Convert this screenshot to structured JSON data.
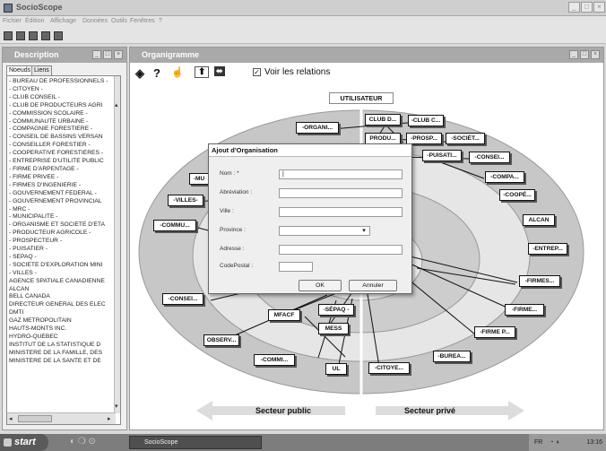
{
  "window": {
    "title": "SocioScope"
  },
  "menu": [
    "Fichier",
    "Édition",
    "Affichage",
    "Données",
    "Outils",
    "Fenêtres",
    "?"
  ],
  "description_panel": {
    "title": "Description",
    "tabs": [
      "Noeuds",
      "Liens"
    ],
    "tree_items": [
      "- BUREAU DE PROFESSIONNELS -",
      "- CITOYEN -",
      "- CLUB CONSEIL -",
      "- CLUB DE PRODUCTEURS AGRI",
      "- COMMISSION SCOLAIRE -",
      "- COMMUNAUTÉ URBAINE -",
      "- COMPAGNIE FORESTIÈRE -",
      "- CONSEIL DE BASSINS VERSAN",
      "- CONSEILLER FORESTIER -",
      "- COOPÉRATIVE FORESTIÈRES -",
      "- ENTREPRISE D'UTILITÉ PUBLIC",
      "- FIRME D'ARPENTAGE -",
      "- FIRME PRIVÉE -",
      "- FIRMES D'INGÉNIERIE -",
      "- GOUVERNEMENT FÉDÉRAL -",
      "- GOUVERNEMENT PROVINCIAL",
      "- MRC -",
      "- MUNICIPALITÉ -",
      "- ORGANISME ET SOCIÉTÉ D'ÉTA",
      "- PRODUCTEUR AGRICOLE -",
      "- PROSPECTEUR -",
      "- PUISATIER -",
      "- SÉPAQ -",
      "- SOCIÉTÉ D'EXPLORATION MINI",
      "- VILLES -",
      "AGENCE SPATIALE CANADIENNE",
      "ALCAN",
      "BELL CANADA",
      "DIRECTEUR GÉNÉRAL DES ÉLEC",
      "DMTI",
      "GAZ MÉTROPOLITAIN",
      "HAUTS-MONTS INC.",
      "HYDRO-QUÉBEC",
      "INSTITUT DE LA STATISTIQUE D",
      "MINISTÈRE DE LA FAMILLE, DES",
      "MINISTÈRE DE LA SANTÉ ET DE"
    ]
  },
  "org_panel": {
    "title": "Organigramme",
    "checkbox_label": "Voir les relations",
    "checkbox_checked": true,
    "center_label": "UTILISATEUR",
    "sector_left": "Secteur public",
    "sector_right": "Secteur privé",
    "nodes": {
      "organi": "-ORGANI...",
      "club_d": "CLUB D...",
      "club_c": "-CLUB C...",
      "produ": "PRODU...",
      "prosp": "-PROSP...",
      "societ": "-SOCIÉT...",
      "puisat": "-PUISATI...",
      "consei_r": "-CONSEI...",
      "compa": "-COMPA...",
      "coope": "-COOPÉ...",
      "mu": "-MU",
      "villes": "-VILLES-",
      "alcan": "ALCAN",
      "commu": "-COMMU...",
      "entrep": "-ENTREP...",
      "firmes": "-FIRMES...",
      "consei_l": "-CONSEI...",
      "firme": "-FIRME...",
      "sepaq": "-SÉPAQ -",
      "mfacf": "MFACF",
      "mess": "MESS",
      "firme_p": "-FIRME P...",
      "observ": "OBSERV...",
      "burea": "-BUREA...",
      "commi": "-COMMI...",
      "ul": "UL",
      "citoye": "-CITOYE..."
    }
  },
  "dialog": {
    "title": "Ajout d'Organisation",
    "fields": [
      {
        "label": "Nom : *",
        "value": "|"
      },
      {
        "label": "Abréviation :",
        "value": ""
      },
      {
        "label": "Ville :",
        "value": ""
      },
      {
        "label": "Province :",
        "value": ""
      },
      {
        "label": "Adresse :",
        "value": ""
      },
      {
        "label": "CodePostal :",
        "value": ""
      }
    ],
    "ok_label": "OK",
    "cancel_label": "Annuler"
  },
  "taskbar": {
    "start_label": "start",
    "app_label": "SocioScope",
    "tray_lang": "FR",
    "clock": "13:16"
  },
  "colors": {
    "panel_title": "#a9a9a9",
    "outer_ring": "#c7c7c7",
    "middle_ring": "#e6e6e6",
    "inner_ring": "#cdcdcd"
  }
}
